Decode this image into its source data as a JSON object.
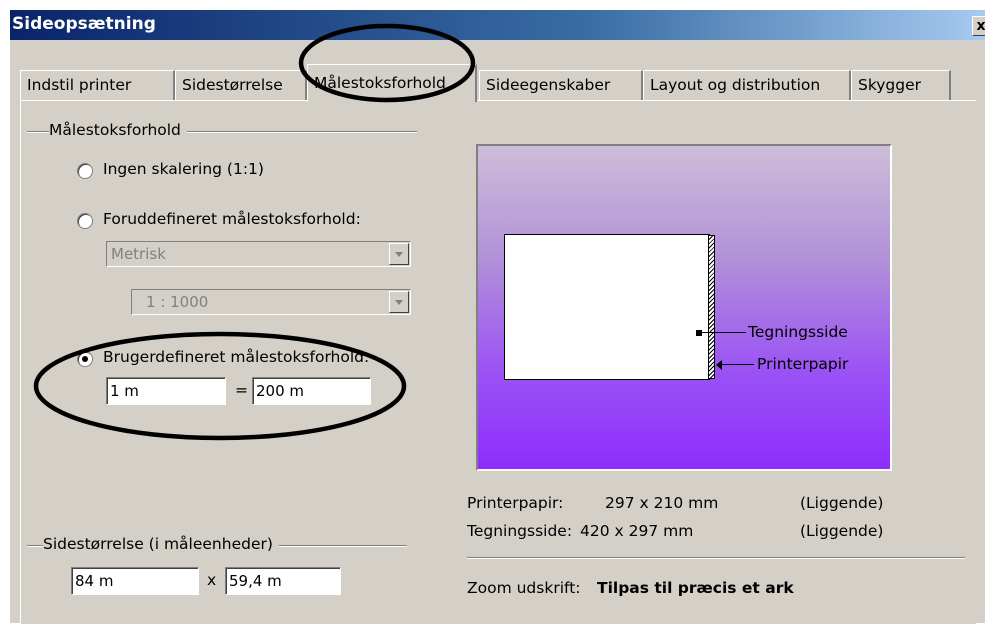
{
  "window": {
    "title": "Sideopsætning",
    "close_label": "x"
  },
  "tabs": [
    {
      "label": "Indstil printer"
    },
    {
      "label": "Sidestørrelse"
    },
    {
      "label": "Målestoksforhold"
    },
    {
      "label": "Sideegenskaber"
    },
    {
      "label": "Layout og distribution"
    },
    {
      "label": "Skygger"
    }
  ],
  "active_tab": "Målestoksforhold",
  "scale_group": {
    "title": "Målestoksforhold",
    "options": [
      {
        "label": "Ingen skalering (1:1)",
        "selected": false
      },
      {
        "label": "Foruddefineret målestoksforhold:",
        "selected": false
      },
      {
        "label": "Brugerdefineret målestoksforhold:",
        "selected": true
      }
    ],
    "predefined_unit": "Metrisk",
    "predefined_ratio": "1 : 1000",
    "custom_left": "1 m",
    "equals": "=",
    "custom_right": "200 m"
  },
  "page_size_group": {
    "title": "Sidestørrelse (i måleenheder)",
    "width": "84 m",
    "times": "x",
    "height": "59,4 m"
  },
  "preview": {
    "drawing_label": "Tegningsside",
    "paper_label": "Printerpapir"
  },
  "info": {
    "printer_paper_label": "Printerpapir:",
    "printer_paper_value": "297 x 210 mm",
    "printer_paper_orientation": "(Liggende)",
    "drawing_page_label": "Tegningsside:",
    "drawing_page_value": "420 x 297 mm",
    "drawing_page_orientation": "(Liggende)",
    "zoom_label": "Zoom udskrift:",
    "zoom_value": "Tilpas til præcis et ark"
  },
  "colors": {
    "titlebar_start": "#0a246a",
    "dialog_face": "#d4d0c8",
    "preview_bottom": "#8f2dfd",
    "highlight_circle": "#000000"
  }
}
